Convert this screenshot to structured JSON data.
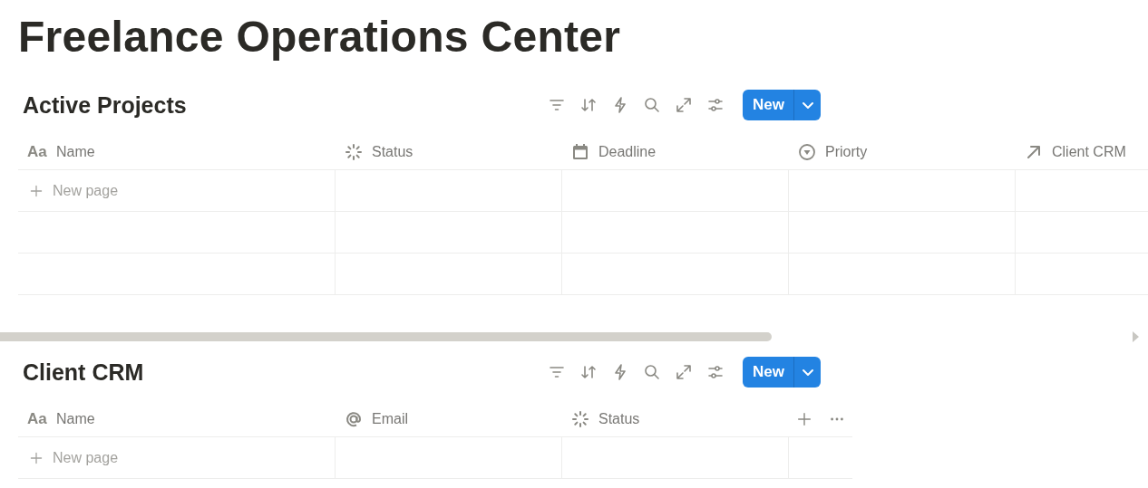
{
  "page_title": "Freelance Operations Center",
  "databases": [
    {
      "title": "Active Projects",
      "new_button": "New",
      "horizontal_scrollbar": true,
      "add_column": false,
      "columns": [
        {
          "name": "Name",
          "kind": "title",
          "icon_text": "Aa"
        },
        {
          "name": "Status",
          "kind": "status"
        },
        {
          "name": "Deadline",
          "kind": "date"
        },
        {
          "name": "Priorty",
          "kind": "select"
        },
        {
          "name": "Client CRM",
          "kind": "relation"
        }
      ],
      "rows": [
        {
          "kind": "new_page",
          "label": "New page"
        },
        {
          "kind": "empty"
        },
        {
          "kind": "empty"
        }
      ]
    },
    {
      "title": "Client CRM",
      "new_button": "New",
      "horizontal_scrollbar": false,
      "add_column": true,
      "columns": [
        {
          "name": "Name",
          "kind": "title",
          "icon_text": "Aa"
        },
        {
          "name": "Email",
          "kind": "email"
        },
        {
          "name": "Status",
          "kind": "status"
        }
      ],
      "rows": [
        {
          "kind": "new_page",
          "label": "New page"
        }
      ]
    }
  ]
}
